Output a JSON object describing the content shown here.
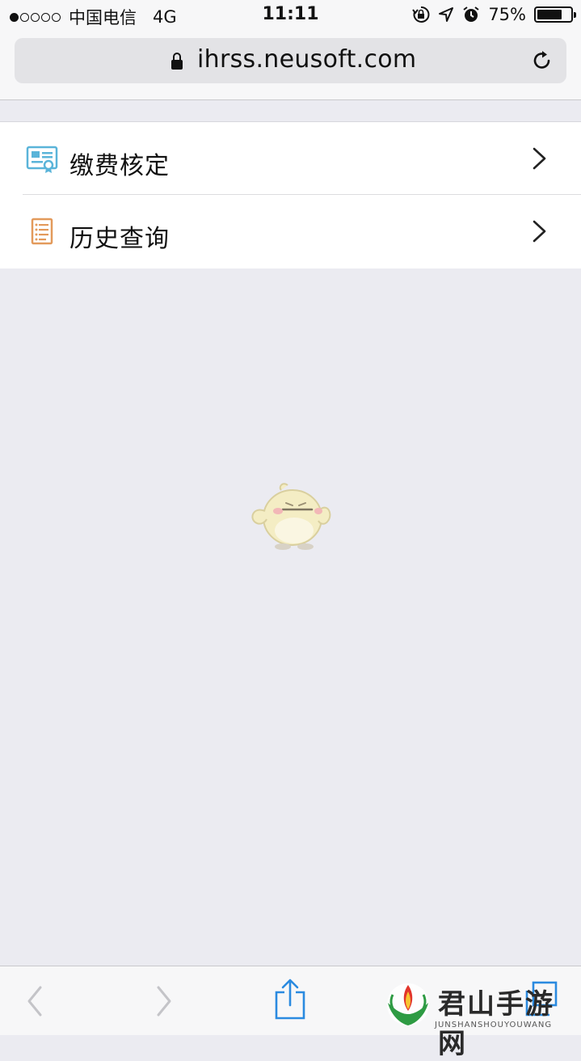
{
  "status_bar": {
    "carrier": "中国电信",
    "network": "4G",
    "time": "11:11",
    "battery_percent": "75%",
    "battery_level": 0.75,
    "signal_strength": 1,
    "icons": [
      "rotation-lock-icon",
      "location-arrow-icon",
      "alarm-icon",
      "battery-icon"
    ]
  },
  "address_bar": {
    "url": "ihrss.neusoft.com",
    "secure": true
  },
  "menu": {
    "items": [
      {
        "label": "缴费核定",
        "icon": "certificate-icon",
        "icon_color": "#5ab4d9"
      },
      {
        "label": "历史查询",
        "icon": "document-list-icon",
        "icon_color": "#e39a5b"
      }
    ]
  },
  "toolbar": {
    "items": [
      "back-icon",
      "forward-icon",
      "share-icon",
      "tabs-icon"
    ]
  },
  "watermark": {
    "title": "君山手游网",
    "subtitle": "JUNSHANSHOUYOUWANG"
  },
  "colors": {
    "background": "#ebebf1",
    "bar_background": "#f7f7f8",
    "toolbar_accent": "#2a8ae0"
  }
}
